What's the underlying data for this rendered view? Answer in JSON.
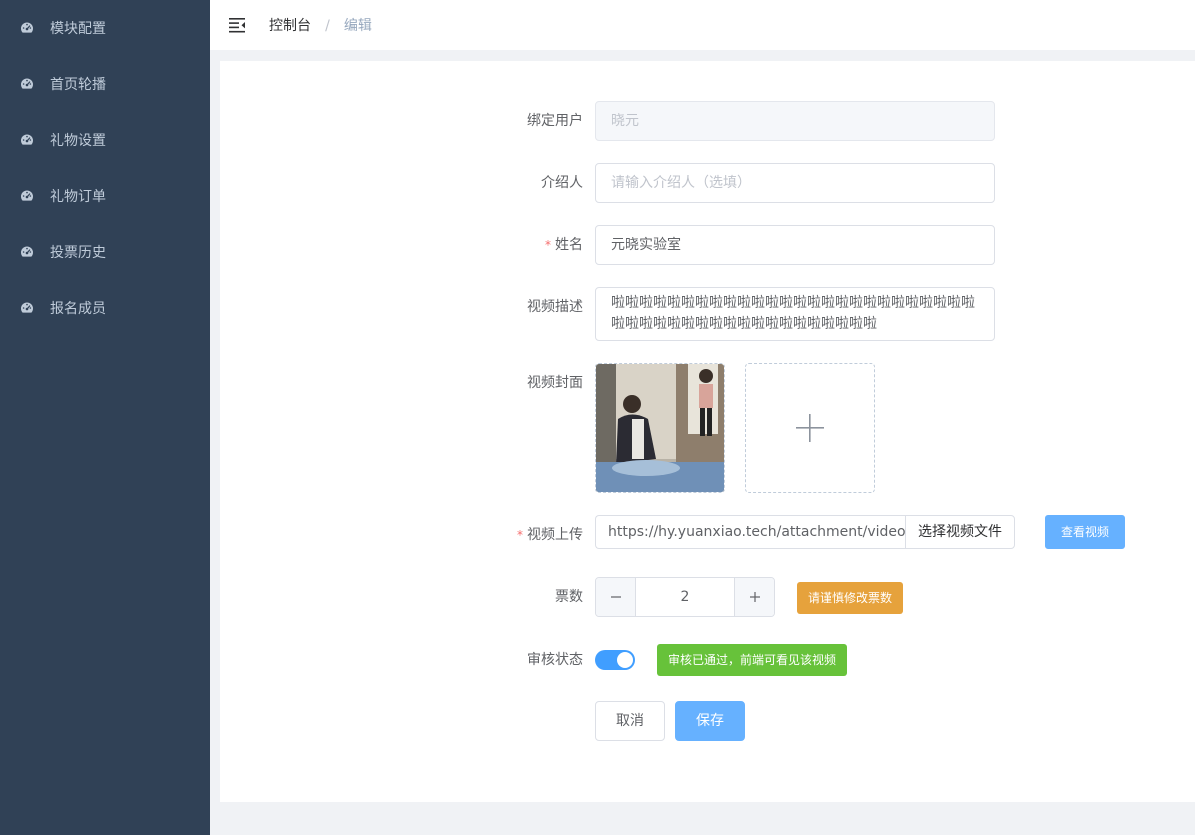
{
  "sidebar": {
    "items": [
      {
        "label": "模块配置",
        "icon": "dashboard-icon"
      },
      {
        "label": "首页轮播",
        "icon": "dashboard-icon"
      },
      {
        "label": "礼物设置",
        "icon": "dashboard-icon"
      },
      {
        "label": "礼物订单",
        "icon": "dashboard-icon"
      },
      {
        "label": "投票历史",
        "icon": "dashboard-icon"
      },
      {
        "label": "报名成员",
        "icon": "dashboard-icon"
      }
    ]
  },
  "header": {
    "breadcrumb_home": "控制台",
    "breadcrumb_sep": "/",
    "breadcrumb_current": "编辑"
  },
  "form": {
    "bind_user": {
      "label": "绑定用户",
      "value": "晓元"
    },
    "referrer": {
      "label": "介绍人",
      "placeholder": "请输入介绍人（选填）"
    },
    "name": {
      "label": "姓名",
      "required_mark": "*",
      "value": "元晓实验室"
    },
    "description": {
      "label": "视频描述",
      "value": "啦啦啦啦啦啦啦啦啦啦啦啦啦啦啦啦啦啦啦啦啦啦啦啦啦啦啦啦啦啦啦啦啦啦啦啦啦啦啦啦啦啦啦啦啦"
    },
    "cover": {
      "label": "视频封面"
    },
    "video_upload": {
      "label": "视频上传",
      "required_mark": "*",
      "value": "https://hy.yuanxiao.tech/attachment/videos",
      "choose_button": "选择视频文件",
      "view_button": "查看视频"
    },
    "votes": {
      "label": "票数",
      "value": "2",
      "warning_button": "请谨慎修改票数"
    },
    "review_status": {
      "label": "审核状态",
      "enabled": true,
      "tag": "审核已通过，前端可看见该视频"
    },
    "actions": {
      "cancel": "取消",
      "save": "保存"
    }
  },
  "colors": {
    "sidebar_bg": "#304156",
    "primary": "#409eff",
    "warning": "#e6a23c",
    "success": "#67c23a",
    "danger": "#f56c6c"
  }
}
